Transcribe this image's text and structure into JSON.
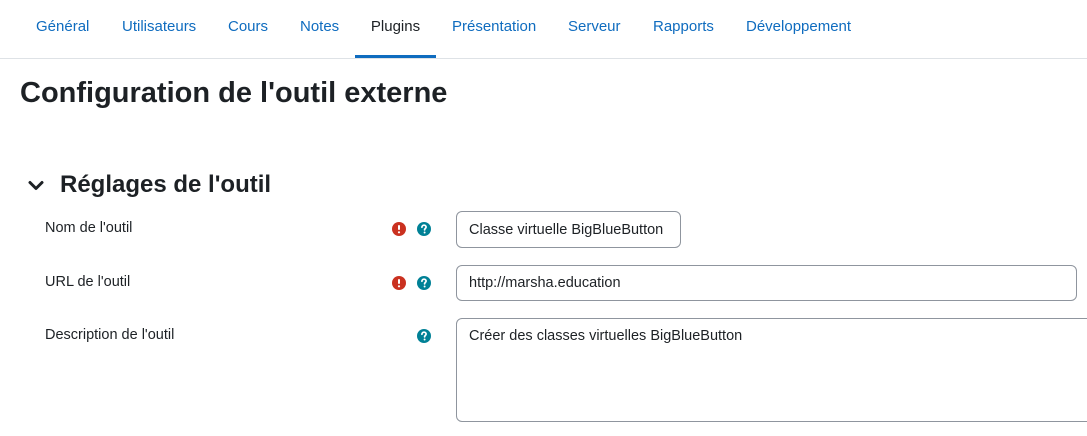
{
  "tabs": [
    {
      "label": "Général",
      "active": false
    },
    {
      "label": "Utilisateurs",
      "active": false
    },
    {
      "label": "Cours",
      "active": false
    },
    {
      "label": "Notes",
      "active": false
    },
    {
      "label": "Plugins",
      "active": true
    },
    {
      "label": "Présentation",
      "active": false
    },
    {
      "label": "Serveur",
      "active": false
    },
    {
      "label": "Rapports",
      "active": false
    },
    {
      "label": "Développement",
      "active": false
    }
  ],
  "page": {
    "title": "Configuration de l'outil externe"
  },
  "section": {
    "title": "Réglages de l'outil",
    "expanded": true,
    "fields": {
      "name": {
        "label": "Nom de l'outil",
        "value": "Classe virtuelle BigBlueButton",
        "required": true
      },
      "url": {
        "label": "URL de l'outil",
        "value": "http://marsha.education",
        "required": true
      },
      "description": {
        "label": "Description de l'outil",
        "value": "Créer des classes virtuelles BigBlueButton",
        "required": false
      }
    }
  },
  "colors": {
    "link": "#0f6cbf",
    "text": "#1d2125",
    "required_icon": "#ca3120",
    "help_icon": "#008196",
    "input_border": "#8f959e",
    "divider": "#dee2e6"
  },
  "icons": {
    "required": "exclamation-circle-icon",
    "help": "question-circle-icon",
    "collapse": "chevron-down-icon"
  }
}
